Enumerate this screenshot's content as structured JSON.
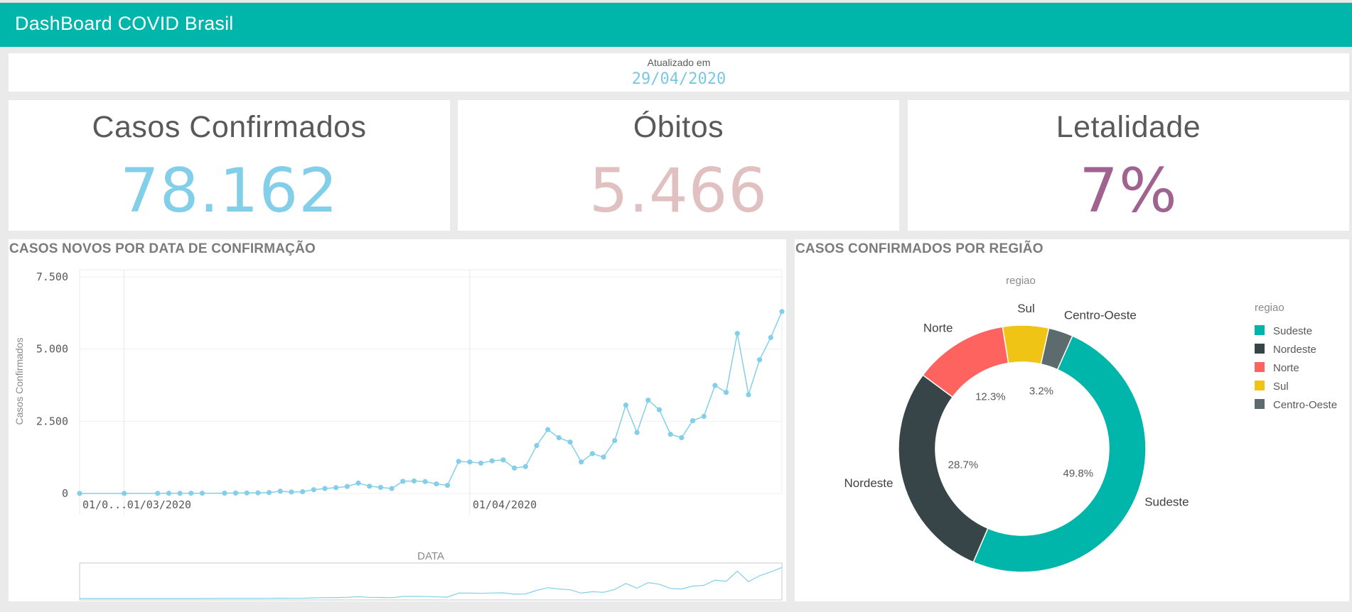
{
  "header": {
    "title": "DashBoard COVID Brasil"
  },
  "updated": {
    "label": "Atualizado em",
    "date": "29/04/2020"
  },
  "kpis": [
    {
      "title": "Casos Confirmados",
      "value": "78.162",
      "color": "#83cfe9"
    },
    {
      "title": "Óbitos",
      "value": "5.466",
      "color": "#e0c0c0"
    },
    {
      "title": "Letalidade",
      "value": "7%",
      "color": "#a0628f"
    }
  ],
  "line_panel": {
    "title": "CASOS NOVOS POR DATA DE CONFIRMAÇÃO"
  },
  "donut_panel": {
    "title": "CASOS CONFIRMADOS POR REGIÃO"
  },
  "chart_data": [
    {
      "type": "line",
      "title": "CASOS NOVOS POR DATA DE CONFIRMAÇÃO",
      "xlabel": "DATA",
      "ylabel": "Casos Confirmados",
      "ylim": [
        0,
        7500
      ],
      "yticks": [
        "7.500",
        "5.000",
        "2.500",
        "0"
      ],
      "ytick_values": [
        7500,
        5000,
        2500,
        0
      ],
      "xtick_labels": [
        "01/0...",
        "01/03/2020",
        "01/04/2020"
      ],
      "xtick_dates": [
        "2020-02-26",
        "2020-03-01",
        "2020-04-01"
      ],
      "color": "#83cfe9",
      "x": [
        "2020-02-26",
        "2020-03-01",
        "2020-03-04",
        "2020-03-05",
        "2020-03-06",
        "2020-03-07",
        "2020-03-08",
        "2020-03-10",
        "2020-03-11",
        "2020-03-12",
        "2020-03-13",
        "2020-03-14",
        "2020-03-15",
        "2020-03-16",
        "2020-03-17",
        "2020-03-18",
        "2020-03-19",
        "2020-03-20",
        "2020-03-21",
        "2020-03-22",
        "2020-03-23",
        "2020-03-24",
        "2020-03-25",
        "2020-03-26",
        "2020-03-27",
        "2020-03-28",
        "2020-03-29",
        "2020-03-30",
        "2020-03-31",
        "2020-04-01",
        "2020-04-02",
        "2020-04-03",
        "2020-04-04",
        "2020-04-05",
        "2020-04-06",
        "2020-04-07",
        "2020-04-08",
        "2020-04-09",
        "2020-04-10",
        "2020-04-11",
        "2020-04-12",
        "2020-04-13",
        "2020-04-14",
        "2020-04-15",
        "2020-04-16",
        "2020-04-17",
        "2020-04-18",
        "2020-04-19",
        "2020-04-20",
        "2020-04-21",
        "2020-04-22",
        "2020-04-23",
        "2020-04-24",
        "2020-04-25",
        "2020-04-26",
        "2020-04-27",
        "2020-04-28",
        "2020-04-29"
      ],
      "values": [
        1,
        1,
        2,
        5,
        5,
        6,
        6,
        9,
        14,
        17,
        20,
        30,
        76,
        50,
        60,
        130,
        170,
        200,
        240,
        360,
        250,
        210,
        170,
        420,
        430,
        410,
        330,
        280,
        1110,
        1090,
        1050,
        1130,
        1160,
        880,
        930,
        1660,
        2210,
        1930,
        1780,
        1090,
        1380,
        1260,
        1830,
        3060,
        2110,
        3230,
        2900,
        2050,
        1930,
        2520,
        2670,
        3740,
        3500,
        5540,
        3420,
        4630,
        5400,
        6300
      ]
    },
    {
      "type": "pie",
      "title": "regiao",
      "legend_title": "regiao",
      "legend_position": "right",
      "categories": [
        "Sudeste",
        "Nordeste",
        "Norte",
        "Sul",
        "Centro-Oeste"
      ],
      "values": [
        49.8,
        28.7,
        12.3,
        6.0,
        3.2
      ],
      "labels": [
        "49.8%",
        "28.7%",
        "12.3%",
        "",
        "3.2%"
      ],
      "colors": [
        "#00b5aa",
        "#384548",
        "#fe635f",
        "#f0c414",
        "#5d6a6e"
      ]
    }
  ]
}
